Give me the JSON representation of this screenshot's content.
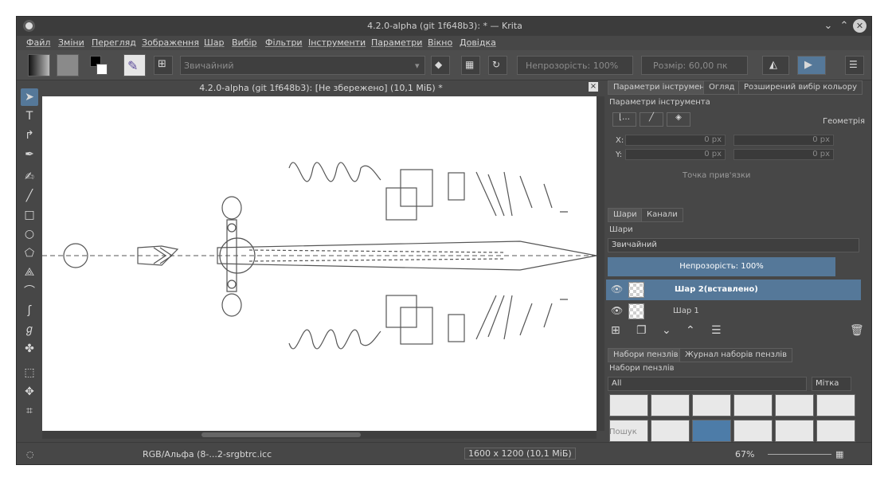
{
  "window": {
    "title": "4.2.0-alpha (git 1f648b3): * — Krita",
    "buttons": {
      "minimize": "⌄",
      "maximize": "⌃",
      "close": "✕"
    }
  },
  "menu": [
    "Файл",
    "Зміни",
    "Перегляд",
    "Зображення",
    "Шар",
    "Вибір",
    "Фільтри",
    "Інструменти",
    "Параметри",
    "Вікно",
    "Довідка"
  ],
  "toolbar": {
    "blend_mode": "Звичайний",
    "opacity_label": "Непрозорість:  100%",
    "size_label": "Розмір:  60,00 пк"
  },
  "document": {
    "title": "4.2.0-alpha (git 1f648b3):  [Не збережено]  (10,1 МіБ) *"
  },
  "docker_tool": {
    "tabs": [
      "Параметри інструмента",
      "Огляд",
      "Розширений вибір кольору"
    ],
    "header": "Параметри інструмента",
    "geometry_label": "Геометрія",
    "x_label": "X:",
    "y_label": "Y:",
    "x_value_1": "0 px",
    "x_value_2": "0 px",
    "y_value_1": "0 px",
    "y_value_2": "0 px",
    "anchor_label": "Точка прив'язки"
  },
  "docker_layers": {
    "tabs": [
      "Шари",
      "Канали"
    ],
    "header": "Шари",
    "blend_mode": "Звичайний",
    "opacity": "Непрозорість:  100%",
    "layers": [
      {
        "name": "Шар 2(вставлено)",
        "selected": true
      },
      {
        "name": "Шар 1",
        "selected": false
      }
    ]
  },
  "docker_brushes": {
    "tabs": [
      "Набори пензлів",
      "Журнал наборів пензлів"
    ],
    "header": "Набори пензлів",
    "filter": "All",
    "tag_button": "Мітка",
    "search_placeholder": "Пошук"
  },
  "status": {
    "color_profile": "RGB/Альфа (8-...2-srgbtrc.icc",
    "image_size": "1600 x 1200 (10,1 МіБ)",
    "zoom": "67%"
  },
  "colors": {
    "accent": "#557899",
    "panel": "#474747",
    "canvas": "#ffffff"
  }
}
